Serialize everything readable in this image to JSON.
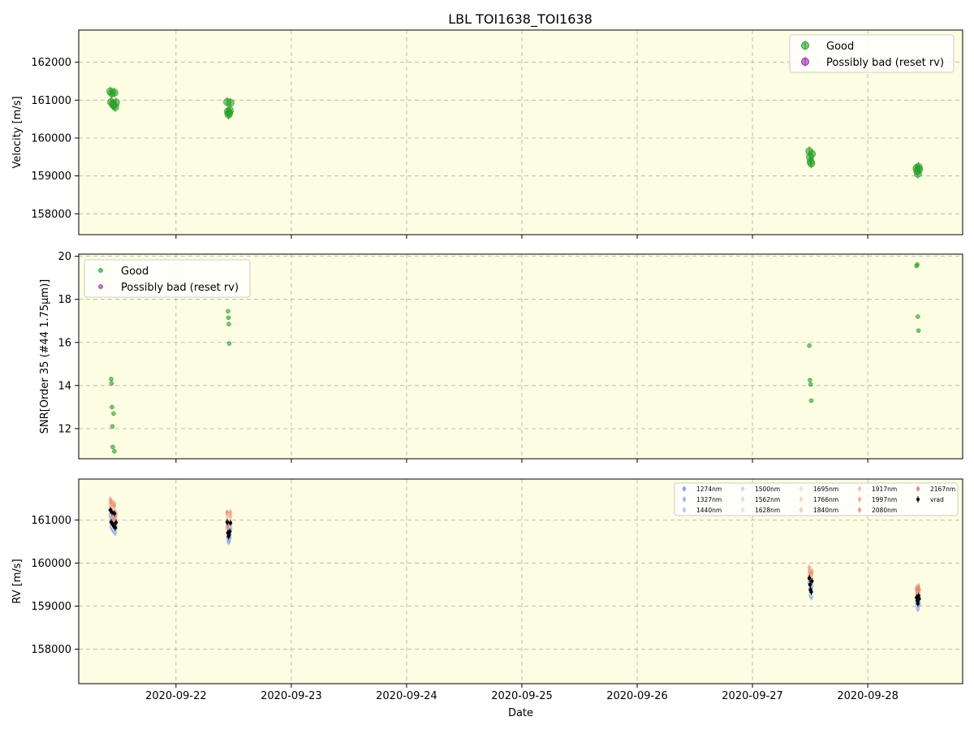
{
  "figure": {
    "title": "LBL TOI1638_TOI1638"
  },
  "colors": {
    "panel_bg": "#fdfde3",
    "good": "#2ca02c",
    "bad": "#9b30a0",
    "vrad": "#000000",
    "grid": "#b0b0b0"
  },
  "chart_data": [
    {
      "type": "scatter",
      "panel": "top",
      "title": "LBL TOI1638_TOI1638",
      "xlabel": "",
      "ylabel": "Velocity [m/s]",
      "xlim": [
        "2020-09-21 03:45",
        "2020-09-28 19:45"
      ],
      "ylim": [
        157450,
        162850
      ],
      "yticks": [
        158000,
        159000,
        160000,
        161000,
        162000
      ],
      "grid": true,
      "legend": {
        "position": "top-right",
        "entries": [
          "Good",
          "Possibly bad (reset rv)"
        ]
      },
      "series": [
        {
          "name": "Good",
          "color": "#2ca02c",
          "x": [
            "2020-09-21 10:20",
            "2020-09-21 10:30",
            "2020-09-21 10:40",
            "2020-09-21 10:50",
            "2020-09-21 11:00",
            "2020-09-21 11:10",
            "2020-09-21 11:20",
            "2020-09-21 11:30",
            "2020-09-22 10:40",
            "2020-09-22 10:48",
            "2020-09-22 10:56",
            "2020-09-22 11:04",
            "2020-09-22 11:12",
            "2020-09-22 11:20",
            "2020-09-27 11:50",
            "2020-09-27 11:58",
            "2020-09-27 12:06",
            "2020-09-27 12:14",
            "2020-09-27 12:22",
            "2020-09-28 10:10",
            "2020-09-28 10:18",
            "2020-09-28 10:26",
            "2020-09-28 10:34",
            "2020-09-28 10:42"
          ],
          "y": [
            161230,
            160950,
            161180,
            160900,
            160870,
            161200,
            160820,
            160940,
            160950,
            160700,
            160620,
            160660,
            160730,
            160930,
            159650,
            159500,
            159380,
            159330,
            159580,
            159200,
            159130,
            159060,
            159240,
            159170
          ]
        },
        {
          "name": "Possibly bad (reset rv)",
          "color": "#9b30a0",
          "x": [],
          "y": []
        }
      ]
    },
    {
      "type": "scatter",
      "panel": "middle",
      "xlabel": "",
      "ylabel": "SNR[Order 35 (#44 1.75μm)]",
      "xlim": [
        "2020-09-21 03:45",
        "2020-09-28 19:45"
      ],
      "ylim": [
        10.6,
        20.1
      ],
      "yticks": [
        12,
        14,
        16,
        18,
        20
      ],
      "grid": true,
      "legend": {
        "position": "top-left",
        "entries": [
          "Good",
          "Possibly bad (reset rv)"
        ]
      },
      "series": [
        {
          "name": "Good",
          "color": "#2ca02c",
          "x": [
            "2020-09-21 10:30",
            "2020-09-21 10:35",
            "2020-09-21 10:40",
            "2020-09-21 10:45",
            "2020-09-21 10:50",
            "2020-09-21 11:00",
            "2020-09-21 11:10",
            "2020-09-22 10:50",
            "2020-09-22 10:55",
            "2020-09-22 11:00",
            "2020-09-22 11:05",
            "2020-09-27 11:50",
            "2020-09-27 11:58",
            "2020-09-27 12:06",
            "2020-09-27 12:14",
            "2020-09-28 10:10",
            "2020-09-28 10:18",
            "2020-09-28 10:26",
            "2020-09-28 10:34"
          ],
          "y": [
            14.3,
            14.1,
            13.0,
            12.1,
            11.15,
            12.7,
            10.95,
            17.45,
            17.15,
            16.85,
            15.95,
            15.85,
            14.25,
            14.05,
            13.3,
            19.55,
            19.62,
            17.2,
            16.55
          ]
        },
        {
          "name": "Possibly bad (reset rv)",
          "color": "#9b30a0",
          "x": [],
          "y": []
        }
      ]
    },
    {
      "type": "scatter",
      "panel": "bottom",
      "xlabel": "Date",
      "ylabel": "RV [m/s]",
      "xlim": [
        "2020-09-21 03:45",
        "2020-09-28 19:45"
      ],
      "ylim": [
        157200,
        161950
      ],
      "yticks": [
        158000,
        159000,
        160000,
        161000
      ],
      "xticks": [
        "2020-09-22",
        "2020-09-23",
        "2020-09-24",
        "2020-09-25",
        "2020-09-26",
        "2020-09-27",
        "2020-09-28"
      ],
      "grid": true,
      "legend": {
        "position": "top-right",
        "entries": [
          "1274nm",
          "1327nm",
          "1440nm",
          "1500nm",
          "1562nm",
          "1628nm",
          "1695nm",
          "1766nm",
          "1840nm",
          "1917nm",
          "1997nm",
          "2080nm",
          "2167nm",
          "vrad"
        ],
        "colors": [
          "#6a8fe8",
          "#86a6ee",
          "#a3bdf3",
          "#bdd0f6",
          "#cddbf4",
          "#d9e0ea",
          "#e6dcd6",
          "#f0d0c2",
          "#f4c2ae",
          "#f3b49c",
          "#ef9f86",
          "#e88a72",
          "#dd7060",
          "#000000"
        ]
      },
      "series": [
        {
          "name": "vrad",
          "color": "#000000",
          "x": [
            "2020-09-21 10:20",
            "2020-09-21 10:30",
            "2020-09-21 10:40",
            "2020-09-21 10:50",
            "2020-09-21 11:00",
            "2020-09-21 11:10",
            "2020-09-21 11:20",
            "2020-09-21 11:30",
            "2020-09-22 10:40",
            "2020-09-22 10:48",
            "2020-09-22 10:56",
            "2020-09-22 11:04",
            "2020-09-22 11:12",
            "2020-09-22 11:20",
            "2020-09-27 11:50",
            "2020-09-27 11:58",
            "2020-09-27 12:06",
            "2020-09-27 12:14",
            "2020-09-27 12:22",
            "2020-09-28 10:10",
            "2020-09-28 10:18",
            "2020-09-28 10:26",
            "2020-09-28 10:34",
            "2020-09-28 10:42"
          ],
          "y": [
            161230,
            160950,
            161180,
            160900,
            160870,
            161150,
            160820,
            160940,
            160950,
            160700,
            160620,
            160660,
            160730,
            160930,
            159650,
            159500,
            159380,
            159330,
            159580,
            159200,
            159130,
            159060,
            159240,
            159170
          ]
        }
      ]
    }
  ]
}
